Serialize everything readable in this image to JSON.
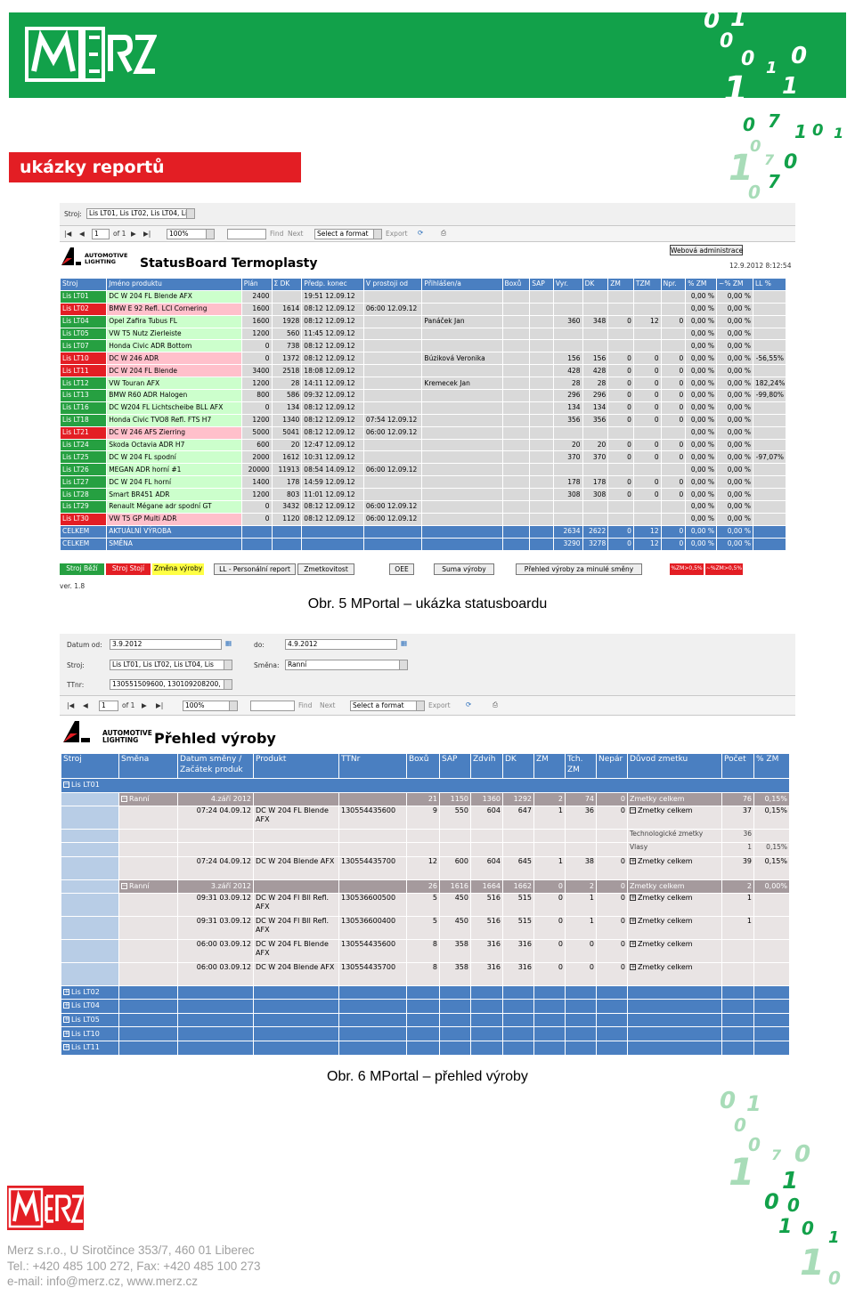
{
  "header": {
    "logo_text": "MERZ",
    "banner": "ukázky reportů"
  },
  "s1": {
    "machine_label": "Stroj:",
    "machine_value": "Lis LT01, Lis LT02, Lis LT04, Lis",
    "page": "1",
    "of": "of 1",
    "zoom": "100%",
    "find": "Find",
    "next": "Next",
    "format": "Select a format",
    "export": "Export",
    "admin_btn": "Webová administrace",
    "logo_small": "AUTOMOTIVE LIGHTING",
    "title": "StatusBoard Termoplasty",
    "timestamp": "12.9.2012 8:12:54",
    "headers": [
      "Stroj",
      "Jméno produktu",
      "Plán",
      "Σ DK",
      "Předp. konec",
      "V prostoji od",
      "Přihlášen/a",
      "Boxů",
      "SAP",
      "Vyr.",
      "DK",
      "ZM",
      "TZM",
      "Npr.",
      "% ZM",
      "~% ZM",
      "LL %"
    ],
    "rows": [
      {
        "st": "g",
        "c": [
          "Lis LT01",
          "DC W 204 FL Blende AFX",
          "2400",
          "",
          "19:51 12.09.12",
          "",
          "",
          "",
          "",
          "",
          "",
          "",
          "",
          "",
          "0,00 %",
          "0,00 %",
          ""
        ]
      },
      {
        "st": "r",
        "c": [
          "Lis LT02",
          "BMW E 92 Refl. LCI Cornering",
          "1600",
          "1614",
          "08:12 12.09.12",
          "06:00 12.09.12",
          "",
          "",
          "",
          "",
          "",
          "",
          "",
          "",
          "0,00 %",
          "0,00 %",
          ""
        ]
      },
      {
        "st": "g",
        "c": [
          "Lis LT04",
          "Opel Zafira Tubus FL",
          "1600",
          "1928",
          "08:12 12.09.12",
          "",
          "Panáček Jan",
          "",
          "",
          "360",
          "348",
          "0",
          "12",
          "0",
          "0,00 %",
          "0,00 %",
          ""
        ]
      },
      {
        "st": "g",
        "c": [
          "Lis LT05",
          "VW T5 Nutz Zierleiste",
          "1200",
          "560",
          "11:45 12.09.12",
          "",
          "",
          "",
          "",
          "",
          "",
          "",
          "",
          "",
          "0,00 %",
          "0,00 %",
          ""
        ]
      },
      {
        "st": "g",
        "c": [
          "Lis LT07",
          "Honda Civic ADR Bottom",
          "0",
          "738",
          "08:12 12.09.12",
          "",
          "",
          "",
          "",
          "",
          "",
          "",
          "",
          "",
          "0,00 %",
          "0,00 %",
          ""
        ]
      },
      {
        "st": "r",
        "c": [
          "Lis LT10",
          "DC W 246 ADR",
          "0",
          "1372",
          "08:12 12.09.12",
          "",
          "Búziková Veronika",
          "",
          "",
          "156",
          "156",
          "0",
          "0",
          "0",
          "0,00 %",
          "0,00 %",
          "-56,55%"
        ]
      },
      {
        "st": "r",
        "c": [
          "Lis LT11",
          "DC W 204 FL Blende",
          "3400",
          "2518",
          "18:08 12.09.12",
          "",
          "",
          "",
          "",
          "428",
          "428",
          "0",
          "0",
          "0",
          "0,00 %",
          "0,00 %",
          ""
        ]
      },
      {
        "st": "g",
        "c": [
          "Lis LT12",
          "VW Touran AFX",
          "1200",
          "28",
          "14:11 12.09.12",
          "",
          "Kremecek Jan",
          "",
          "",
          "28",
          "28",
          "0",
          "0",
          "0",
          "0,00 %",
          "0,00 %",
          "182,24%"
        ]
      },
      {
        "st": "g",
        "c": [
          "Lis LT13",
          "BMW R60 ADR Halogen",
          "800",
          "586",
          "09:32 12.09.12",
          "",
          "",
          "",
          "",
          "296",
          "296",
          "0",
          "0",
          "0",
          "0,00 %",
          "0,00 %",
          "-99,80%"
        ]
      },
      {
        "st": "g",
        "c": [
          "Lis LT16",
          "DC W204 FL Lichtscheibe BLL AFX",
          "0",
          "134",
          "08:12 12.09.12",
          "",
          "",
          "",
          "",
          "134",
          "134",
          "0",
          "0",
          "0",
          "0,00 %",
          "0,00 %",
          ""
        ]
      },
      {
        "st": "g",
        "c": [
          "Lis LT18",
          "Honda Civic TVO8 Refl. FTS H7",
          "1200",
          "1340",
          "08:12 12.09.12",
          "07:54 12.09.12",
          "",
          "",
          "",
          "356",
          "356",
          "0",
          "0",
          "0",
          "0,00 %",
          "0,00 %",
          ""
        ]
      },
      {
        "st": "r",
        "c": [
          "Lis LT21",
          "DC W 246 AFS Zierring",
          "5000",
          "5041",
          "08:12 12.09.12",
          "06:00 12.09.12",
          "",
          "",
          "",
          "",
          "",
          "",
          "",
          "",
          "0,00 %",
          "0,00 %",
          ""
        ]
      },
      {
        "st": "g",
        "c": [
          "Lis LT24",
          "Skoda Octavia ADR H7",
          "600",
          "20",
          "12:47 12.09.12",
          "",
          "",
          "",
          "",
          "20",
          "20",
          "0",
          "0",
          "0",
          "0,00 %",
          "0,00 %",
          ""
        ]
      },
      {
        "st": "g",
        "c": [
          "Lis LT25",
          "DC W 204 FL spodní",
          "2000",
          "1612",
          "10:31 12.09.12",
          "",
          "",
          "",
          "",
          "370",
          "370",
          "0",
          "0",
          "0",
          "0,00 %",
          "0,00 %",
          "-97,07%"
        ]
      },
      {
        "st": "g",
        "c": [
          "Lis LT26",
          "MEGAN ADR horní #1",
          "20000",
          "11913",
          "08:54 14.09.12",
          "06:00 12.09.12",
          "",
          "",
          "",
          "",
          "",
          "",
          "",
          "",
          "0,00 %",
          "0,00 %",
          ""
        ]
      },
      {
        "st": "g",
        "c": [
          "Lis LT27",
          "DC W 204 FL horní",
          "1400",
          "178",
          "14:59 12.09.12",
          "",
          "",
          "",
          "",
          "178",
          "178",
          "0",
          "0",
          "0",
          "0,00 %",
          "0,00 %",
          ""
        ]
      },
      {
        "st": "g",
        "c": [
          "Lis LT28",
          "Smart BR451 ADR",
          "1200",
          "803",
          "11:01 12.09.12",
          "",
          "",
          "",
          "",
          "308",
          "308",
          "0",
          "0",
          "0",
          "0,00 %",
          "0,00 %",
          ""
        ]
      },
      {
        "st": "g",
        "c": [
          "Lis LT29",
          "Renault Mégane adr spodní GT",
          "0",
          "3432",
          "08:12 12.09.12",
          "06:00 12.09.12",
          "",
          "",
          "",
          "",
          "",
          "",
          "",
          "",
          "0,00 %",
          "0,00 %",
          ""
        ]
      },
      {
        "st": "r",
        "c": [
          "Lis LT30",
          "VW T5 GP Multi ADR",
          "0",
          "1120",
          "08:12 12.09.12",
          "06:00 12.09.12",
          "",
          "",
          "",
          "",
          "",
          "",
          "",
          "",
          "0,00 %",
          "0,00 %",
          ""
        ]
      }
    ],
    "totals": [
      [
        "CELKEM",
        "AKTUÁLNÍ VÝROBA",
        "",
        "",
        "",
        "",
        "",
        "",
        "",
        "2634",
        "2622",
        "0",
        "12",
        "0",
        "0,00 %",
        "0,00 %",
        ""
      ],
      [
        "CELKEM",
        "SMĚNA",
        "",
        "",
        "",
        "",
        "",
        "",
        "",
        "3290",
        "3278",
        "0",
        "12",
        "0",
        "0,00 %",
        "0,00 %",
        ""
      ]
    ],
    "legend": {
      "running": "Stroj Běží",
      "stopped": "Stroj Stojí",
      "change": "Změna výroby"
    },
    "buttons": [
      "LL - Personální report",
      "Zmetkovitost",
      "OEE",
      "Suma výroby",
      "Přehled výroby za minulé směny"
    ],
    "red_legend": [
      "%ZM>0,5%",
      "~%ZM>0,5%"
    ],
    "version": "ver. 1.8"
  },
  "caption1": "Obr. 5 MPortal – ukázka statusboardu",
  "s2": {
    "date_from_label": "Datum od:",
    "date_from": "3.9.2012",
    "date_to_label": "do:",
    "date_to": "4.9.2012",
    "machine_label": "Stroj:",
    "machine_value": "Lis LT01, Lis LT02, Lis LT04, Lis",
    "shift_label": "Směna:",
    "shift_value": "Ranní",
    "ttnr_label": "TTnr:",
    "ttnr_value": "130551509600, 130109208200,",
    "page": "1",
    "of": "of 1",
    "zoom": "100%",
    "find": "Find",
    "next": "Next",
    "format": "Select a format",
    "export": "Export",
    "logo_small": "AUTOMOTIVE LIGHTING",
    "title": "Přehled výroby",
    "headers": [
      "Stroj",
      "Směna",
      "Datum směny / Začátek produk",
      "Produkt",
      "TTNr",
      "Boxů",
      "SAP",
      "Zdvih",
      "DK",
      "ZM",
      "Tch. ZM",
      "Nepár",
      "Důvod zmetku",
      "Počet",
      "% ZM"
    ],
    "groups": [
      "Lis LT01",
      "Lis LT02",
      "Lis LT04",
      "Lis LT05",
      "Lis LT10",
      "Lis LT11"
    ],
    "sub1": [
      "Ranní",
      "4.září 2012",
      "",
      "",
      "21",
      "1150",
      "1360",
      "1292",
      "2",
      "74",
      "0",
      "Zmetky celkem",
      "76",
      "0,15%"
    ],
    "det": [
      [
        "07:24 04.09.12",
        "DC W 204 FL Blende AFX",
        "130554435600",
        "9",
        "550",
        "604",
        "647",
        "1",
        "36",
        "0",
        "Zmetky celkem",
        "37",
        "0,15%"
      ],
      [
        "07:24 04.09.12",
        "DC W 204 Blende AFX",
        "130554435700",
        "12",
        "600",
        "604",
        "645",
        "1",
        "38",
        "0",
        "Zmetky celkem",
        "39",
        "0,15%"
      ]
    ],
    "det_sub": [
      [
        "Technologické zmetky",
        "36",
        ""
      ],
      [
        "Vlasy",
        "1",
        "0,15%"
      ]
    ],
    "sub2": [
      "Ranní",
      "3.září 2012",
      "",
      "",
      "26",
      "1616",
      "1664",
      "1662",
      "0",
      "2",
      "0",
      "Zmetky celkem",
      "2",
      "0,00%"
    ],
    "det2": [
      [
        "09:31 03.09.12",
        "DC W 204 Fl Bll Refl. AFX",
        "130536600500",
        "5",
        "450",
        "516",
        "515",
        "0",
        "1",
        "0",
        "Zmetky celkem",
        "1",
        ""
      ],
      [
        "09:31 03.09.12",
        "DC W 204 Fl Bll Refl. AFX",
        "130536600400",
        "5",
        "450",
        "516",
        "515",
        "0",
        "1",
        "0",
        "Zmetky celkem",
        "1",
        ""
      ],
      [
        "06:00 03.09.12",
        "DC W 204 FL Blende AFX",
        "130554435600",
        "8",
        "358",
        "316",
        "316",
        "0",
        "0",
        "0",
        "Zmetky celkem",
        "",
        ""
      ],
      [
        "06:00 03.09.12",
        "DC W 204 Blende AFX",
        "130554435700",
        "8",
        "358",
        "316",
        "316",
        "0",
        "0",
        "0",
        "Zmetky celkem",
        "",
        ""
      ]
    ]
  },
  "caption2": "Obr. 6 MPortal – přehled výroby",
  "footer": {
    "line1": "Merz s.r.o., U Sirotčince 353/7, 460 01 Liberec",
    "line2": "Tel.: +420 485 100 272, Fax: +420 485 100 273",
    "line3": "e-mail: info@merz.cz, www.merz.cz"
  },
  "colors": {
    "green": "#12a14a",
    "red": "#e31e24",
    "blue": "#4a7fc1"
  }
}
